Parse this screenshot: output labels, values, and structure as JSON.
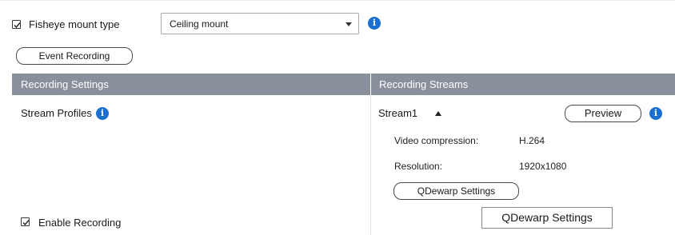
{
  "mount": {
    "checkbox_checked": true,
    "label": "Fisheye mount type",
    "select_value": "Ceiling mount"
  },
  "buttons": {
    "event_recording": "Event Recording",
    "preview": "Preview",
    "qdewarp_pill": "QDewarp Settings",
    "qdewarp_rect": "QDewarp Settings"
  },
  "table": {
    "left_header": "Recording Settings",
    "right_header": "Recording Streams"
  },
  "settings": {
    "stream_profiles_label": "Stream Profiles",
    "enable_recording_label": "Enable Recording",
    "enable_recording_checked": true
  },
  "stream": {
    "name": "Stream1",
    "expanded": true,
    "fields": [
      {
        "label": "Video compression:",
        "value": "H.264"
      },
      {
        "label": "Resolution:",
        "value": "1920x1080"
      }
    ]
  },
  "icons": {
    "info_glyph": "i",
    "info_color": "#1b6fd1",
    "header_color": "#8a8f9c"
  }
}
